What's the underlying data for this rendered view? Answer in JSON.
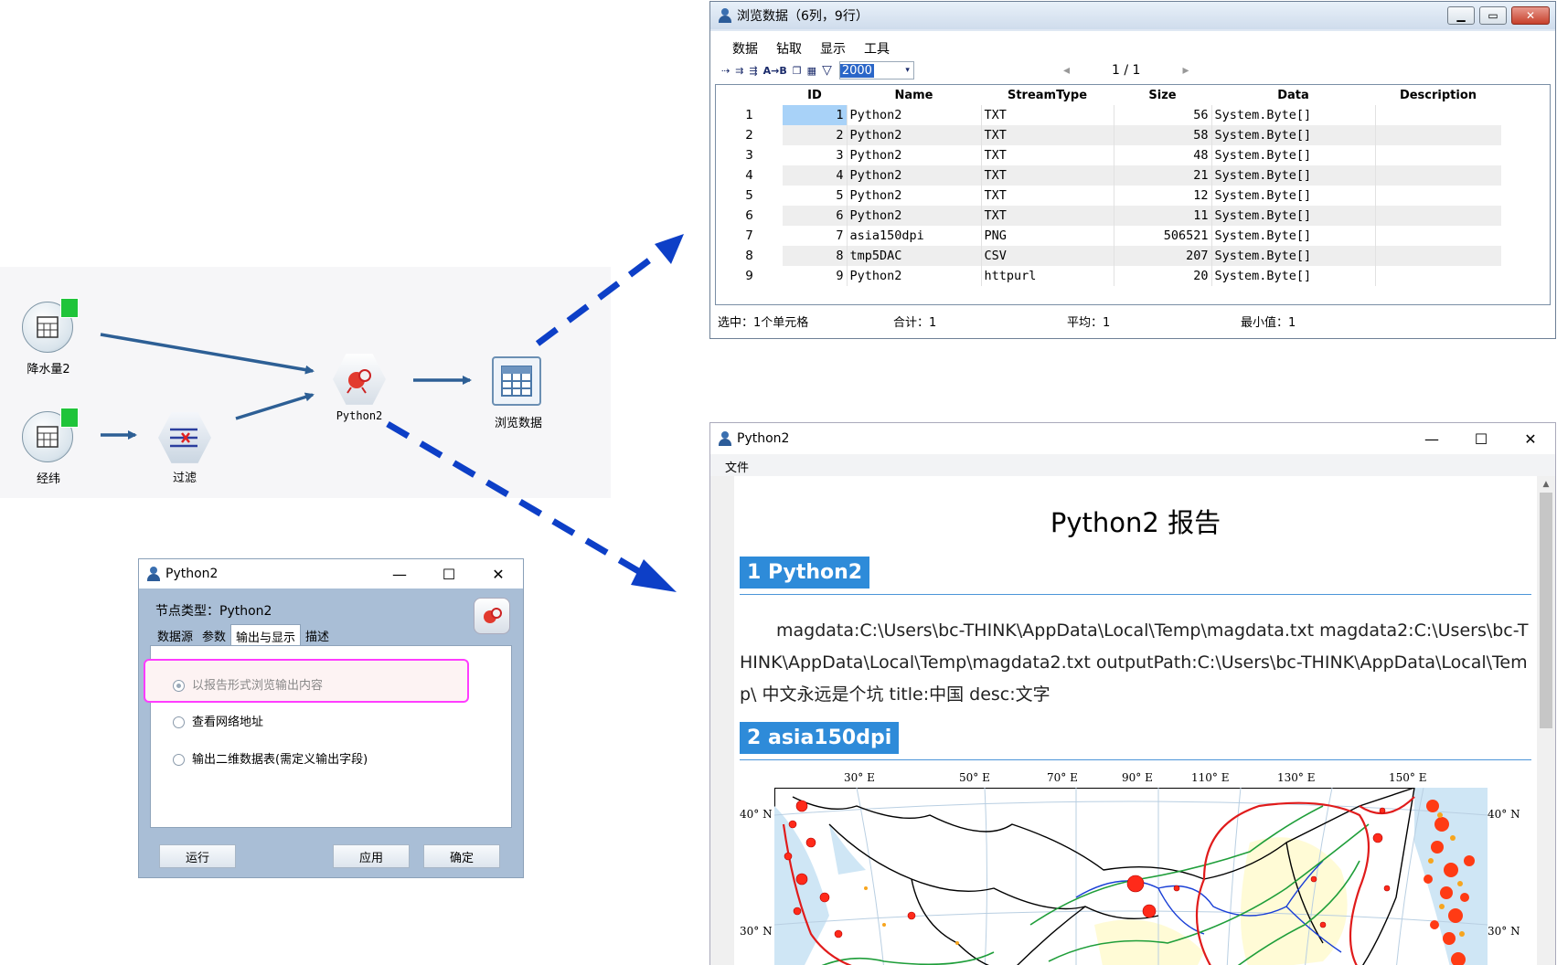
{
  "flow": {
    "nodes": {
      "rain": "降水量2",
      "latlon": "经纬",
      "filter": "过滤",
      "python": "Python2",
      "browse": "浏览数据"
    }
  },
  "browse_window": {
    "title": "浏览数据（6列，9行）",
    "menu": [
      "数据",
      "钻取",
      "显示",
      "工具"
    ],
    "row_limit": "2000",
    "pager": "1 / 1",
    "columns": [
      "ID",
      "Name",
      "StreamType",
      "Size",
      "Data",
      "Description"
    ],
    "rows": [
      [
        "1",
        "1",
        "Python2",
        "TXT",
        "56",
        "System.Byte[]",
        ""
      ],
      [
        "2",
        "2",
        "Python2",
        "TXT",
        "58",
        "System.Byte[]",
        ""
      ],
      [
        "3",
        "3",
        "Python2",
        "TXT",
        "48",
        "System.Byte[]",
        ""
      ],
      [
        "4",
        "4",
        "Python2",
        "TXT",
        "21",
        "System.Byte[]",
        ""
      ],
      [
        "5",
        "5",
        "Python2",
        "TXT",
        "12",
        "System.Byte[]",
        ""
      ],
      [
        "6",
        "6",
        "Python2",
        "TXT",
        "11",
        "System.Byte[]",
        ""
      ],
      [
        "7",
        "7",
        "asia150dpi",
        "PNG",
        "506521",
        "System.Byte[]",
        ""
      ],
      [
        "8",
        "8",
        "tmp5DAC",
        "CSV",
        "207",
        "System.Byte[]",
        ""
      ],
      [
        "9",
        "9",
        "Python2",
        "httpurl",
        "20",
        "System.Byte[]",
        ""
      ]
    ],
    "status": {
      "selected": "选中：1个单元格",
      "total": "合计：1",
      "avg": "平均：1",
      "min": "最小值：1"
    }
  },
  "config_window": {
    "title": "Python2",
    "node_type": "节点类型：Python2",
    "tabs": [
      "数据源",
      "参数",
      "输出与显示",
      "描述"
    ],
    "active_tab": 2,
    "options": [
      "以报告形式浏览输出内容",
      "查看网络地址",
      "输出二维数据表(需定义输出字段)"
    ],
    "selected_option": 0,
    "buttons": {
      "run": "运行",
      "apply": "应用",
      "ok": "确定"
    }
  },
  "report_window": {
    "title": "Python2",
    "menu_file": "文件",
    "heading": "Python2 报告",
    "sec1": "1 Python2",
    "paragraph": "magdata:C:\\Users\\bc-THINK\\AppData\\Local\\Temp\\magdata.txt magdata2:C:\\Users\\bc-THINK\\AppData\\Local\\Temp\\magdata2.txt outputPath:C:\\Users\\bc-THINK\\AppData\\Local\\Temp\\ 中文永远是个坑 title:中国 desc:文字",
    "sec2": "2 asia150dpi",
    "map": {
      "lon_labels": [
        "30° E",
        "50° E",
        "70° E",
        "90° E",
        "110° E",
        "130° E",
        "150° E"
      ],
      "lat_labels": [
        "40° N",
        "30° N"
      ]
    }
  },
  "colors": {
    "arrow": "#2d5f95",
    "dash_arrow": "#0d3fc7",
    "highlight": "#ff3cff",
    "section": "#2e8bd9"
  }
}
